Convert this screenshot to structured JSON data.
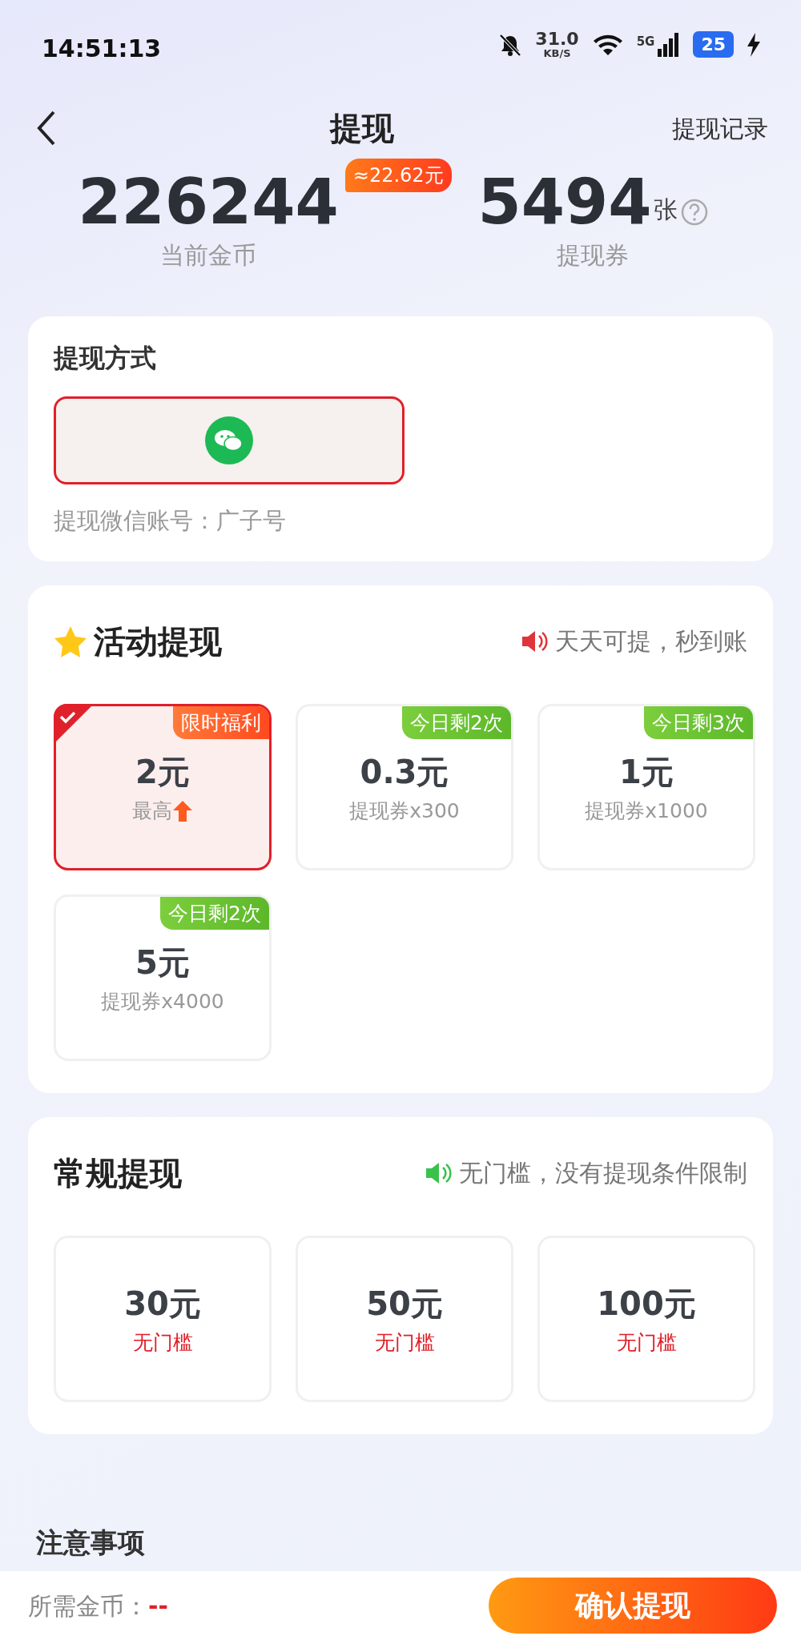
{
  "status_bar": {
    "time": "14:51:13",
    "net_speed": "31.0",
    "net_unit": "KB/S",
    "network": "5G",
    "battery": "25"
  },
  "header": {
    "title": "提现",
    "action": "提现记录"
  },
  "stats": [
    {
      "value": "226244",
      "label": "当前金币",
      "badge": "≈22.62元",
      "help": false
    },
    {
      "value": "5494",
      "unit": "张",
      "label": "提现券",
      "help": true
    }
  ],
  "method": {
    "title": "提现方式",
    "options": [
      {
        "kind": "wechat",
        "selected": true
      }
    ],
    "account": "提现微信账号：广子号"
  },
  "activity": {
    "title": "活动提现",
    "note": "天天可提，秒到账",
    "items": [
      {
        "amount": "2元",
        "sub": "最高",
        "tag": "限时福利",
        "kind": "boost",
        "selected": true
      },
      {
        "amount": "0.3元",
        "sub": "提现券x300",
        "tag": "今日剩2次",
        "kind": "quota",
        "selected": false
      },
      {
        "amount": "1元",
        "sub": "提现券x1000",
        "tag": "今日剩3次",
        "kind": "quota",
        "selected": false
      },
      {
        "amount": "5元",
        "sub": "提现券x4000",
        "tag": "今日剩2次",
        "kind": "quota",
        "selected": false
      }
    ]
  },
  "regular": {
    "title": "常规提现",
    "note": "无门槛，没有提现条件限制",
    "items": [
      {
        "amount": "30元",
        "sub": "无门槛",
        "selected": false
      },
      {
        "amount": "50元",
        "sub": "无门槛",
        "selected": false
      },
      {
        "amount": "100元",
        "sub": "无门槛",
        "selected": false
      }
    ]
  },
  "notice": {
    "title": "注意事项"
  },
  "footer": {
    "label": "所需金币：",
    "value": "--",
    "button": "确认提现"
  }
}
